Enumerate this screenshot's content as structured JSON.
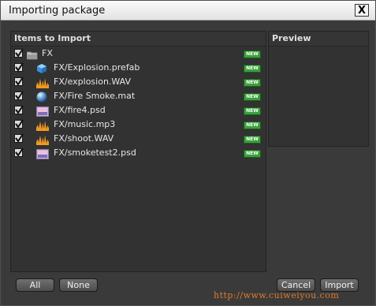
{
  "window": {
    "title": "Importing package",
    "close_label": "X"
  },
  "items_panel": {
    "header": "Items to Import",
    "folder": {
      "label": "FX",
      "checked": true,
      "badge": "NEW"
    },
    "files": [
      {
        "label": "FX/Explosion.prefab",
        "icon": "prefab-cube-icon",
        "checked": true,
        "badge": "NEW"
      },
      {
        "label": "FX/explosion.WAV",
        "icon": "audio-icon",
        "checked": true,
        "badge": "NEW"
      },
      {
        "label": "FX/Fire Smoke.mat",
        "icon": "material-sphere-icon",
        "checked": true,
        "badge": "NEW"
      },
      {
        "label": "FX/fire4.psd",
        "icon": "image-icon",
        "checked": true,
        "badge": "NEW"
      },
      {
        "label": "FX/music.mp3",
        "icon": "audio-icon",
        "checked": true,
        "badge": "NEW"
      },
      {
        "label": "FX/shoot.WAV",
        "icon": "audio-icon",
        "checked": true,
        "badge": "NEW"
      },
      {
        "label": "FX/smoketest2.psd",
        "icon": "image-icon",
        "checked": true,
        "badge": "NEW"
      }
    ]
  },
  "preview_panel": {
    "header": "Preview"
  },
  "buttons": {
    "all": "All",
    "none": "None",
    "cancel": "Cancel",
    "import": "Import"
  },
  "watermark": "http://www.cuiweiyou.com",
  "colors": {
    "background": "#3a3a3a",
    "panel": "#323232",
    "badge": "#3aa13a",
    "watermark": "#e07b2e"
  }
}
